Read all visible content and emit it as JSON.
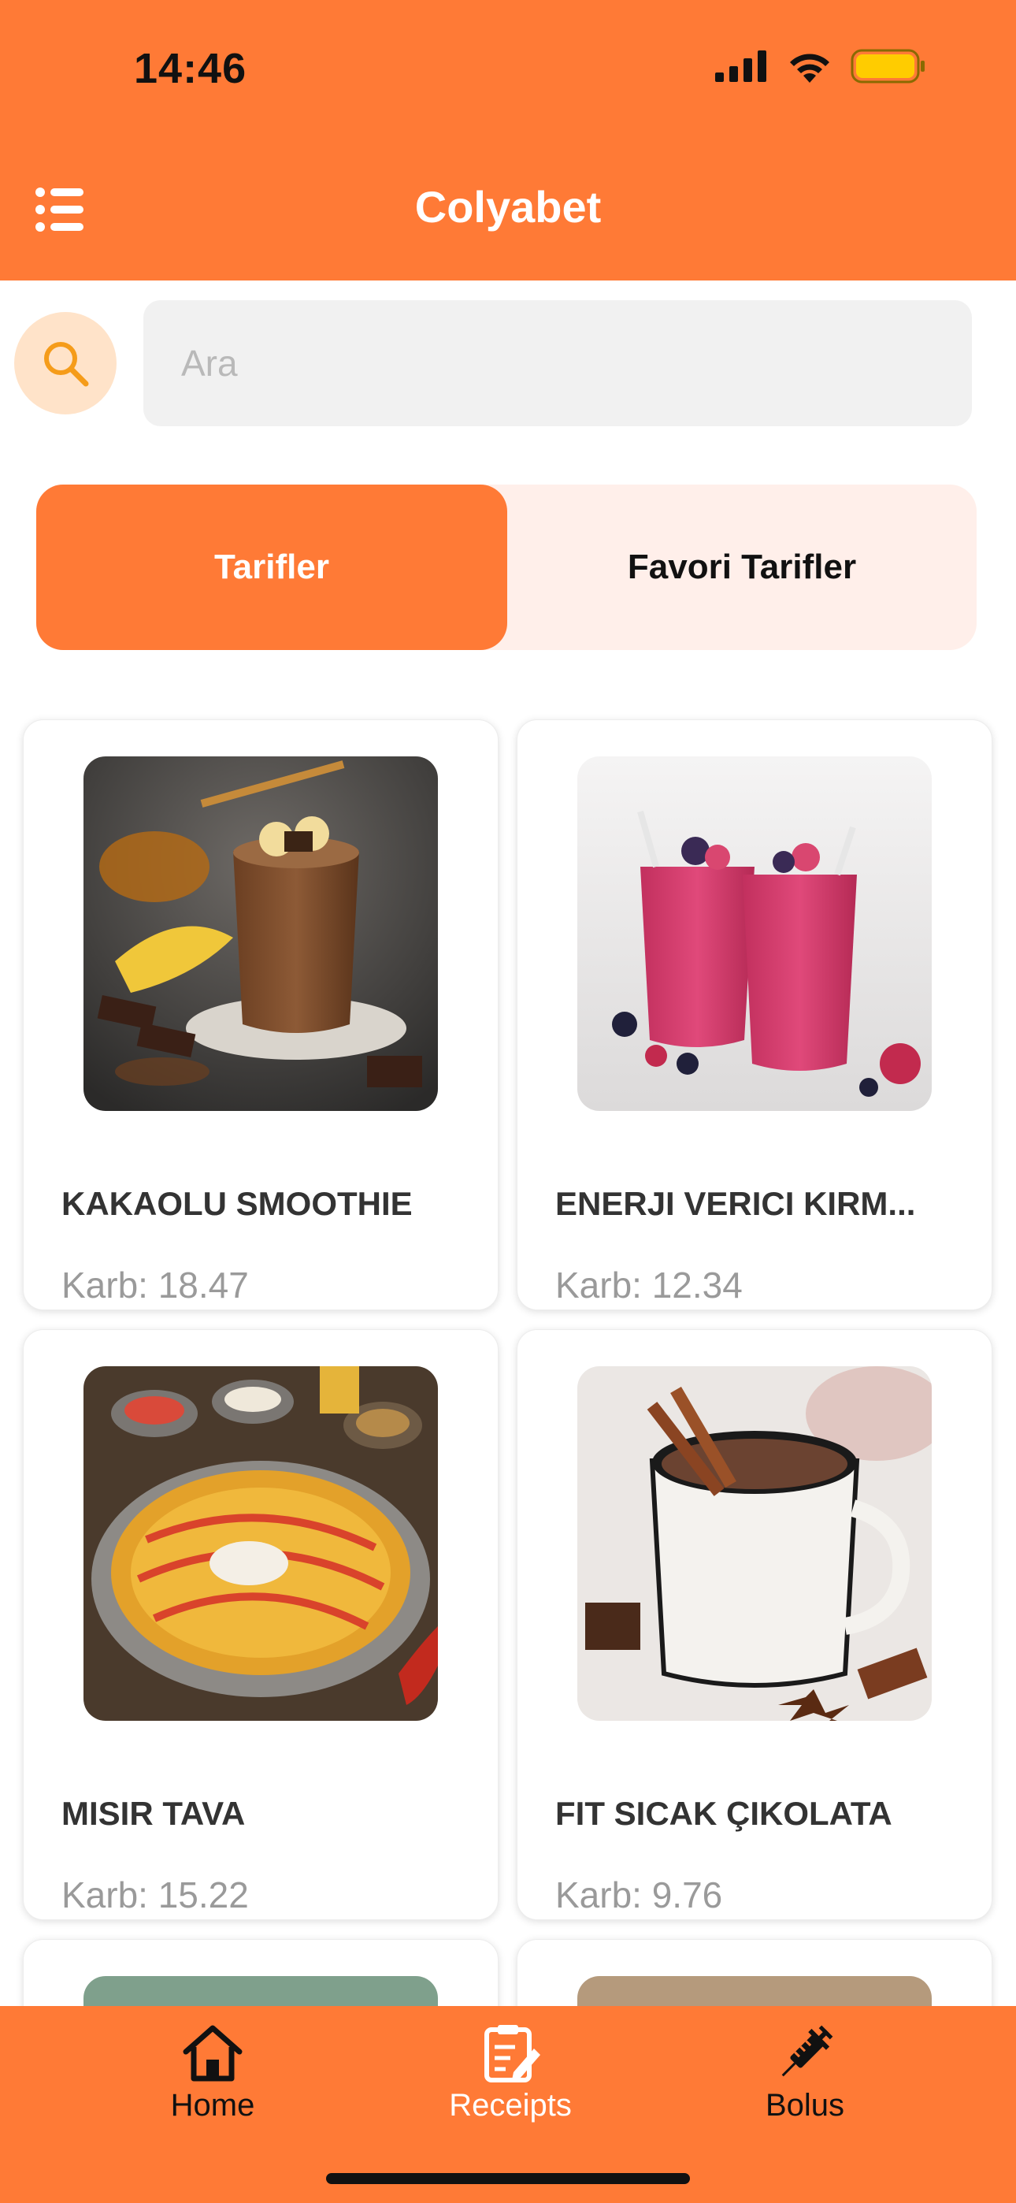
{
  "status_bar": {
    "time": "14:46"
  },
  "header": {
    "title": "Colyabet",
    "menu_icon": "list-menu-icon"
  },
  "search": {
    "placeholder": "Ara",
    "icon": "search-icon"
  },
  "tabs": [
    {
      "label": "Tarifler",
      "active": true
    },
    {
      "label": "Favori Tarifler",
      "active": false
    }
  ],
  "recipes": [
    {
      "title": "KAKAOLU SMOOTHIE",
      "karb": "Karb: 18.47"
    },
    {
      "title": "ENERJI VERICI KIRM...",
      "karb": "Karb: 12.34"
    },
    {
      "title": "MISIR TAVA",
      "karb": "Karb: 15.22"
    },
    {
      "title": "FIT SICAK ÇIKOLATA",
      "karb": "Karb: 9.76"
    }
  ],
  "bottom_nav": [
    {
      "label": "Home",
      "icon": "home-icon",
      "active": true
    },
    {
      "label": "Receipts",
      "icon": "receipt-icon",
      "active": false
    },
    {
      "label": "Bolus",
      "icon": "syringe-icon",
      "active": false
    }
  ],
  "colors": {
    "brand": "#FF7A36",
    "tab_inactive_bg": "#FFEFEA",
    "search_circle_bg": "#FFE3C9",
    "search_icon": "#F59C1A"
  }
}
